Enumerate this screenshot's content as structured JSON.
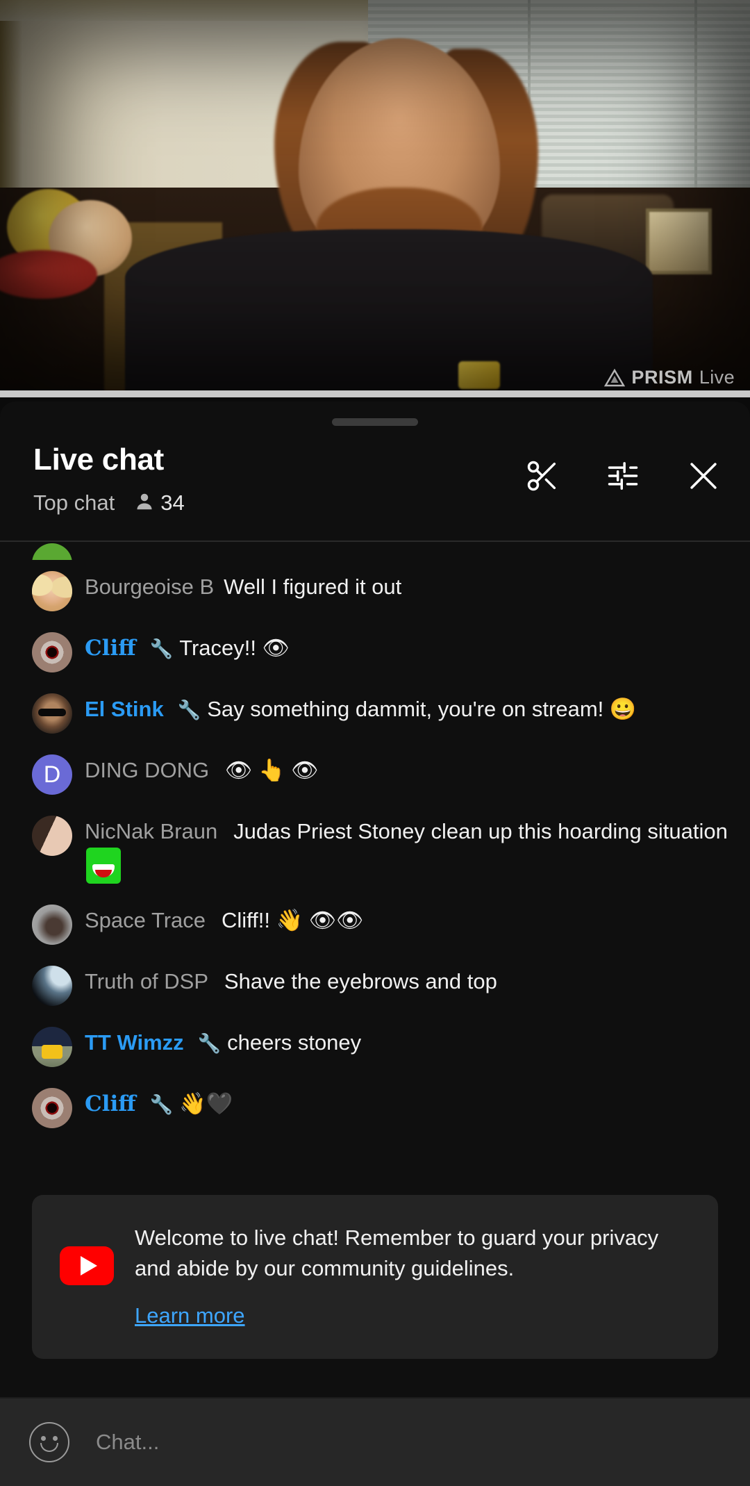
{
  "video": {
    "watermark_brand": "PRISM",
    "watermark_suffix": "Live"
  },
  "chat_panel": {
    "title": "Live chat",
    "subtitle": "Top chat",
    "viewer_count": "34",
    "icons": {
      "clip": "scissors-icon",
      "settings": "tune-icon",
      "close": "close-icon"
    }
  },
  "messages": [
    {
      "avatar": "av-green",
      "username": "",
      "text": "",
      "mod": false,
      "partial": true
    },
    {
      "avatar": "av-blonde",
      "username": "Bourgeoise B",
      "text": "Well I figured it out",
      "mod": false
    },
    {
      "avatar": "av-eye",
      "username": "Cliff",
      "badge": "🔧",
      "text": "Tracey!! 👁",
      "mod": true,
      "fancy": true
    },
    {
      "avatar": "av-sun",
      "username": "El Stink",
      "badge": "🔧",
      "text": "Say something dammit, you're on stream! 😀",
      "mod": true
    },
    {
      "avatar": "av-letter",
      "avatar_letter": "D",
      "username": "DING DONG",
      "text": "👁 👆 👁",
      "mod": false
    },
    {
      "avatar": "av-couple",
      "username": "NicNak Braun",
      "text": "Judas Priest Stoney clean up this hoarding situation",
      "custom_emoji": true,
      "mod": false
    },
    {
      "avatar": "av-space",
      "username": "Space Trace",
      "text": "Cliff!! 👋 👁👁",
      "mod": false
    },
    {
      "avatar": "av-dark",
      "username": "Truth of DSP",
      "text": "Shave the eyebrows and top",
      "mod": false
    },
    {
      "avatar": "av-car",
      "username": "TT Wimzz",
      "badge": "🔧",
      "text": "cheers stoney",
      "mod": true
    },
    {
      "avatar": "av-eye",
      "username": "Cliff",
      "badge": "🔧",
      "text": "👋🖤",
      "mod": true,
      "fancy": true
    }
  ],
  "notice": {
    "text": "Welcome to live chat! Remember to guard your privacy and abide by our community guidelines.",
    "link_label": "Learn more",
    "link_color": "#3ea6ff",
    "brand_color": "#ff0000"
  },
  "input": {
    "placeholder": "Chat...",
    "emoji_icon": "emoji-smiley-icon"
  },
  "colors": {
    "sheet_bg": "#0f0f0f",
    "mod_blue": "#2b9bf4",
    "username_gray": "#a0a0a0",
    "message_white": "#f1f1f1",
    "input_bar": "#272727"
  }
}
